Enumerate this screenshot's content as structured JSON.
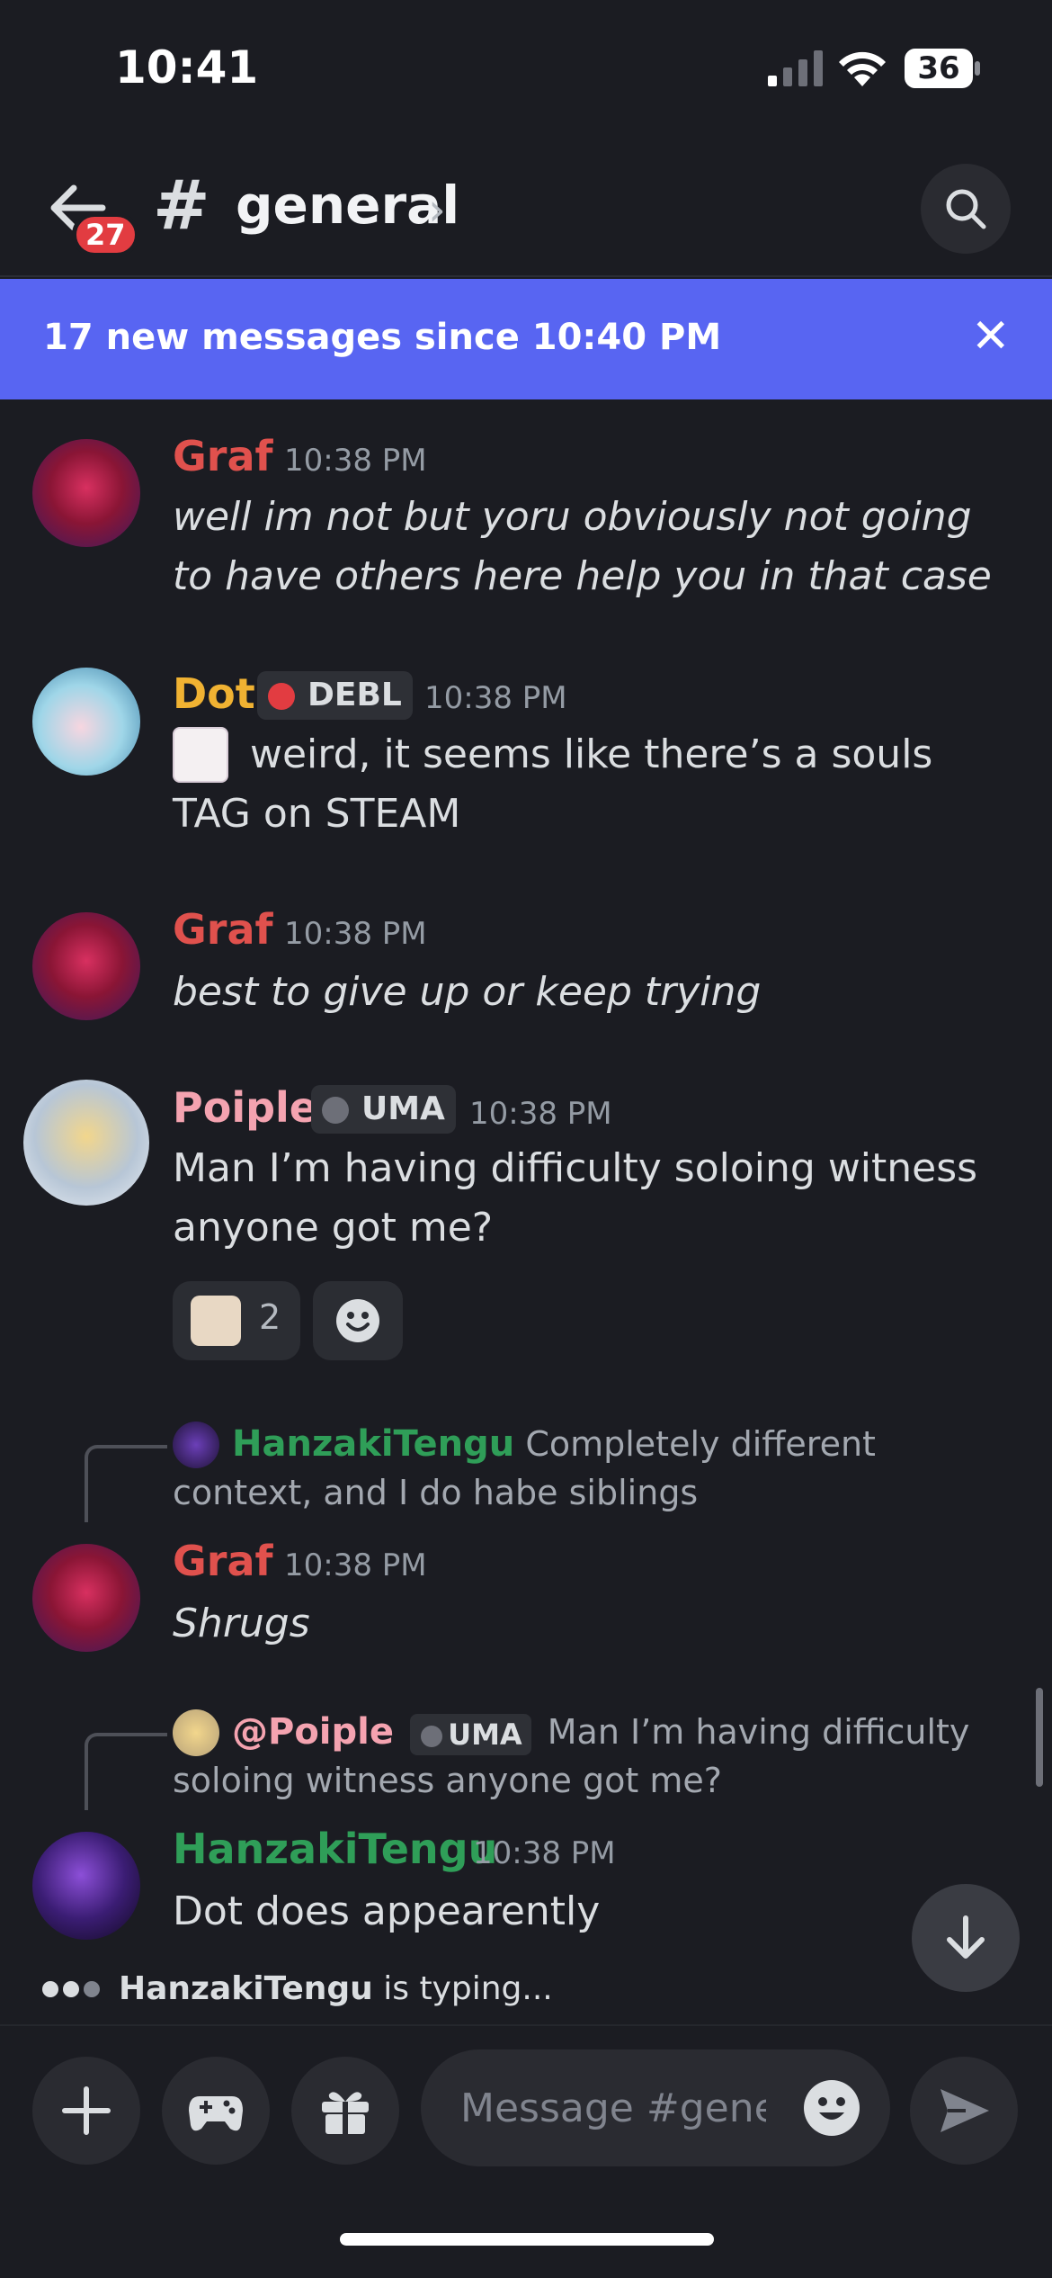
{
  "status": {
    "time": "10:41",
    "battery": "36"
  },
  "header": {
    "badge": "27",
    "hash": "#",
    "channel": "general",
    "chevron": "›"
  },
  "banner": {
    "text": "17 new messages since 10:40 PM",
    "close": "✕"
  },
  "messages": [
    {
      "author": "Graf",
      "time": "10:38 PM",
      "text": "well im not but yoru obviously not going to have others here help you in that case",
      "color": "#e0514d"
    },
    {
      "author": "Dot",
      "tag": "DEBL",
      "time": "10:38 PM",
      "text": "weird, it seems like there’s a souls TAG on STEAM",
      "color": "#f0b232"
    },
    {
      "author": "Graf",
      "time": "10:38 PM",
      "text": "best to give up or keep trying",
      "color": "#e0514d"
    },
    {
      "author": "Poiple",
      "tag": "UMA",
      "time": "10:38 PM",
      "text": "Man I’m having difficulty soloing witness anyone got me?",
      "color": "#f4a3b0",
      "reaction_count": "2"
    },
    {
      "reply_author": "HanzakiTengu",
      "reply_text": "Completely different context, and I do habe siblings",
      "author": "Graf",
      "time": "10:38 PM",
      "text": "Shrugs",
      "color": "#e0514d",
      "reply_color": "#2f9e58"
    },
    {
      "reply_author": "@Poiple",
      "reply_tag": "UMA",
      "reply_text": "Man I’m having difficulty soloing witness anyone got me?",
      "author": "HanzakiTengu",
      "time": "10:38 PM",
      "text": "Dot does appearently",
      "color": "#2f9e58",
      "reply_color": "#f4a3b0"
    }
  ],
  "typing": {
    "name": "HanzakiTengu",
    "suffix": " is typing..."
  },
  "composer": {
    "placeholder": "Message #gene..."
  }
}
